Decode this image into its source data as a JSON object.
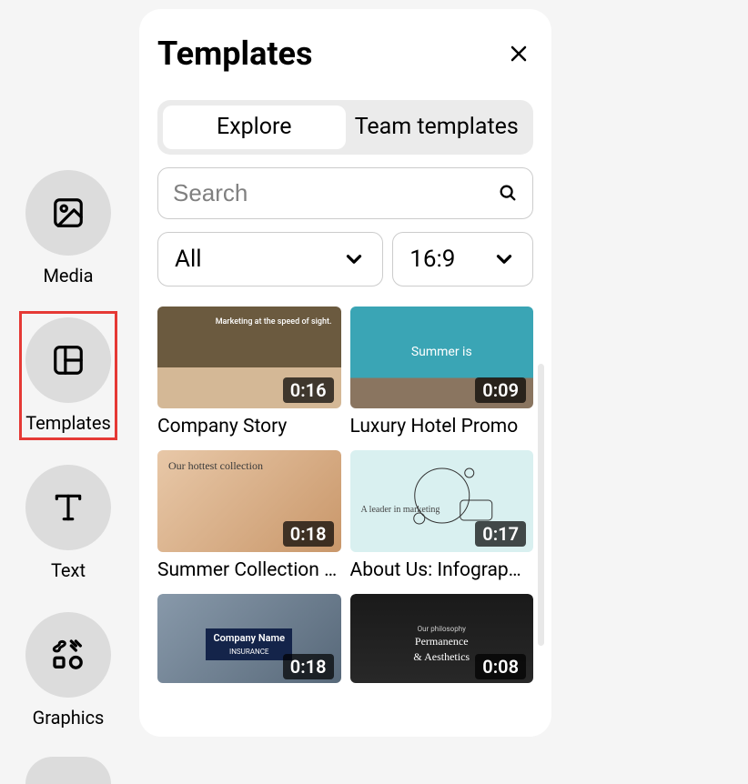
{
  "sidebar": {
    "items": [
      {
        "label": "Media"
      },
      {
        "label": "Templates"
      },
      {
        "label": "Text"
      },
      {
        "label": "Graphics"
      }
    ]
  },
  "panel": {
    "title": "Templates",
    "tabs": {
      "explore": "Explore",
      "team": "Team templates"
    },
    "search": {
      "placeholder": "Search"
    },
    "filters": {
      "category": "All",
      "aspect": "16:9"
    }
  },
  "templates": [
    {
      "title": "Company Story",
      "duration": "0:16",
      "overlay": "Marketing at the speed of sight."
    },
    {
      "title": "Luxury Hotel Promo",
      "duration": "0:09",
      "overlay": "Summer is"
    },
    {
      "title": "Summer Collection …",
      "duration": "0:18",
      "overlay": "Our hottest collection"
    },
    {
      "title": "About Us: Infograp…",
      "duration": "0:17",
      "overlay": "A leader in marketing"
    },
    {
      "title": "",
      "duration": "0:18",
      "overlay_line1": "Company Name",
      "overlay_line2": "INSURANCE"
    },
    {
      "title": "",
      "duration": "0:08",
      "overlay_line1": "Our philosophy",
      "overlay_line2": "Permanence",
      "overlay_line3": "& Aesthetics"
    }
  ]
}
